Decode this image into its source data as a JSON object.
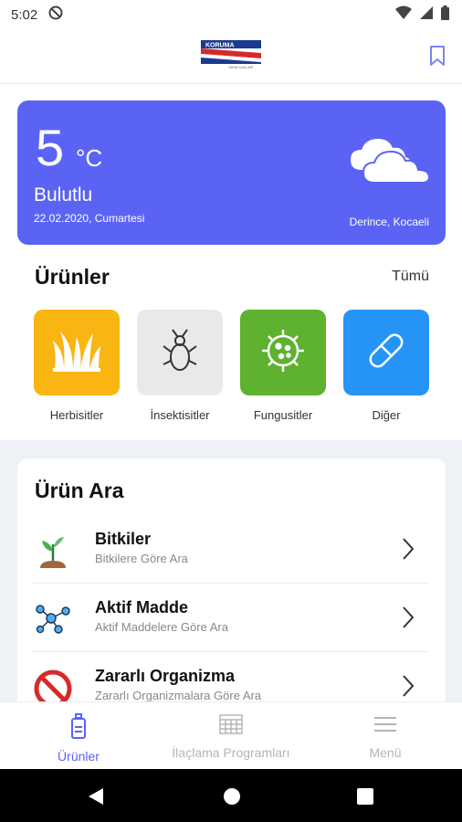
{
  "status": {
    "time": "5:02"
  },
  "app_bar": {
    "logo_text": "KORUMA",
    "logo_sub": "TARIM İLAÇLARI"
  },
  "weather": {
    "temperature": "5",
    "unit": "°C",
    "condition": "Bulutlu",
    "date": "22.02.2020, Cumartesi",
    "location": "Derince, Kocaeli",
    "icon": "cloud-icon",
    "card_color": "#5b63f5"
  },
  "products": {
    "title": "Ürünler",
    "see_all": "Tümü",
    "categories": [
      {
        "label": "Herbisitler",
        "icon": "grass-icon",
        "color": "#f9b512"
      },
      {
        "label": "İnsektisitler",
        "icon": "bug-icon",
        "color": "#e9e9e9"
      },
      {
        "label": "Fungusitler",
        "icon": "virus-icon",
        "color": "#5fb130"
      },
      {
        "label": "Diğer",
        "icon": "pill-icon",
        "color": "#2694f6"
      }
    ]
  },
  "search": {
    "title": "Ürün Ara",
    "items": [
      {
        "title": "Bitkiler",
        "subtitle": "Bitkilere Göre Ara",
        "icon": "plant-icon"
      },
      {
        "title": "Aktif Madde",
        "subtitle": "Aktif Maddelere Göre Ara",
        "icon": "molecule-icon"
      },
      {
        "title": "Zararlı Organizma",
        "subtitle": "Zararlı Organizmalara Göre Ara",
        "icon": "prohibited-icon"
      }
    ]
  },
  "bottom_nav": {
    "items": [
      {
        "label": "Ürünler",
        "icon": "bottle-icon",
        "active": true
      },
      {
        "label": "İlaçlama Programları",
        "icon": "calendar-icon",
        "active": false
      },
      {
        "label": "Menü",
        "icon": "menu-icon",
        "active": false
      }
    ],
    "active_color": "#5b63f5",
    "inactive_color": "#b5b5b5"
  }
}
